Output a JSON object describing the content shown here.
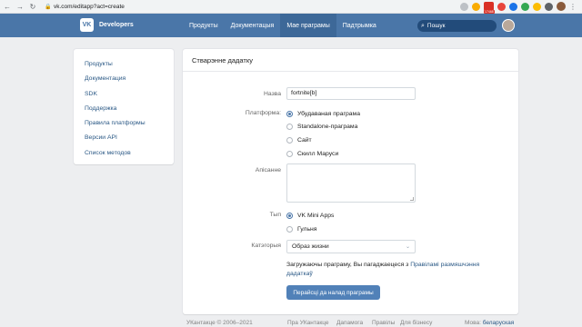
{
  "browser": {
    "url": "vk.com/editapp?act=create",
    "mail_badge": "17468",
    "back_glyph": "←",
    "forward_glyph": "→",
    "reload_glyph": "↻",
    "lock_glyph": "🔒",
    "menu_glyph": "⋮"
  },
  "header": {
    "logo_text": "VK",
    "brand": "Developers",
    "nav": [
      "Продукты",
      "Документацыя",
      "Мае праграмы",
      "Падтрымка"
    ],
    "active_nav_index": 2,
    "search_placeholder": "Пошук",
    "search_glyph": "⌕",
    "bg_color": "#4a76a8"
  },
  "sidebar": {
    "items": [
      "Продукты",
      "Документация",
      "SDK",
      "Поддержка",
      "Правила платформы",
      "Версии API",
      "Список методов"
    ]
  },
  "form": {
    "title": "Стварэнне дадатку",
    "name_label": "Назва",
    "name_value": "fortnite[b]",
    "platform_label": "Платформа:",
    "platforms": [
      "Убудаваная праграма",
      "Standalone-праграма",
      "Сайт",
      "Скилл Маруси"
    ],
    "platform_selected": 0,
    "description_label": "Апісанне",
    "type_label": "Тып",
    "types": [
      "VK Mini Apps",
      "Гульня"
    ],
    "type_selected": 0,
    "category_label": "Катэгорыя",
    "category_value": "Образ жизни",
    "chevron_glyph": "⌄",
    "agreement_text": "Загружаючы праграму, Вы пагаджаецеся з ",
    "agreement_link": "Правіламі размяшчэння дадаткаў",
    "submit_label": "Перайсці да налад праграмы",
    "button_color": "#5181b8"
  },
  "footer": {
    "copyright": "УКантакце © 2006–2021",
    "links": [
      "Пра УКантакце",
      "Дапамога",
      "Правілы",
      "Для бізнесу"
    ],
    "language_label": "Мова:",
    "language_value": "беларуская"
  }
}
